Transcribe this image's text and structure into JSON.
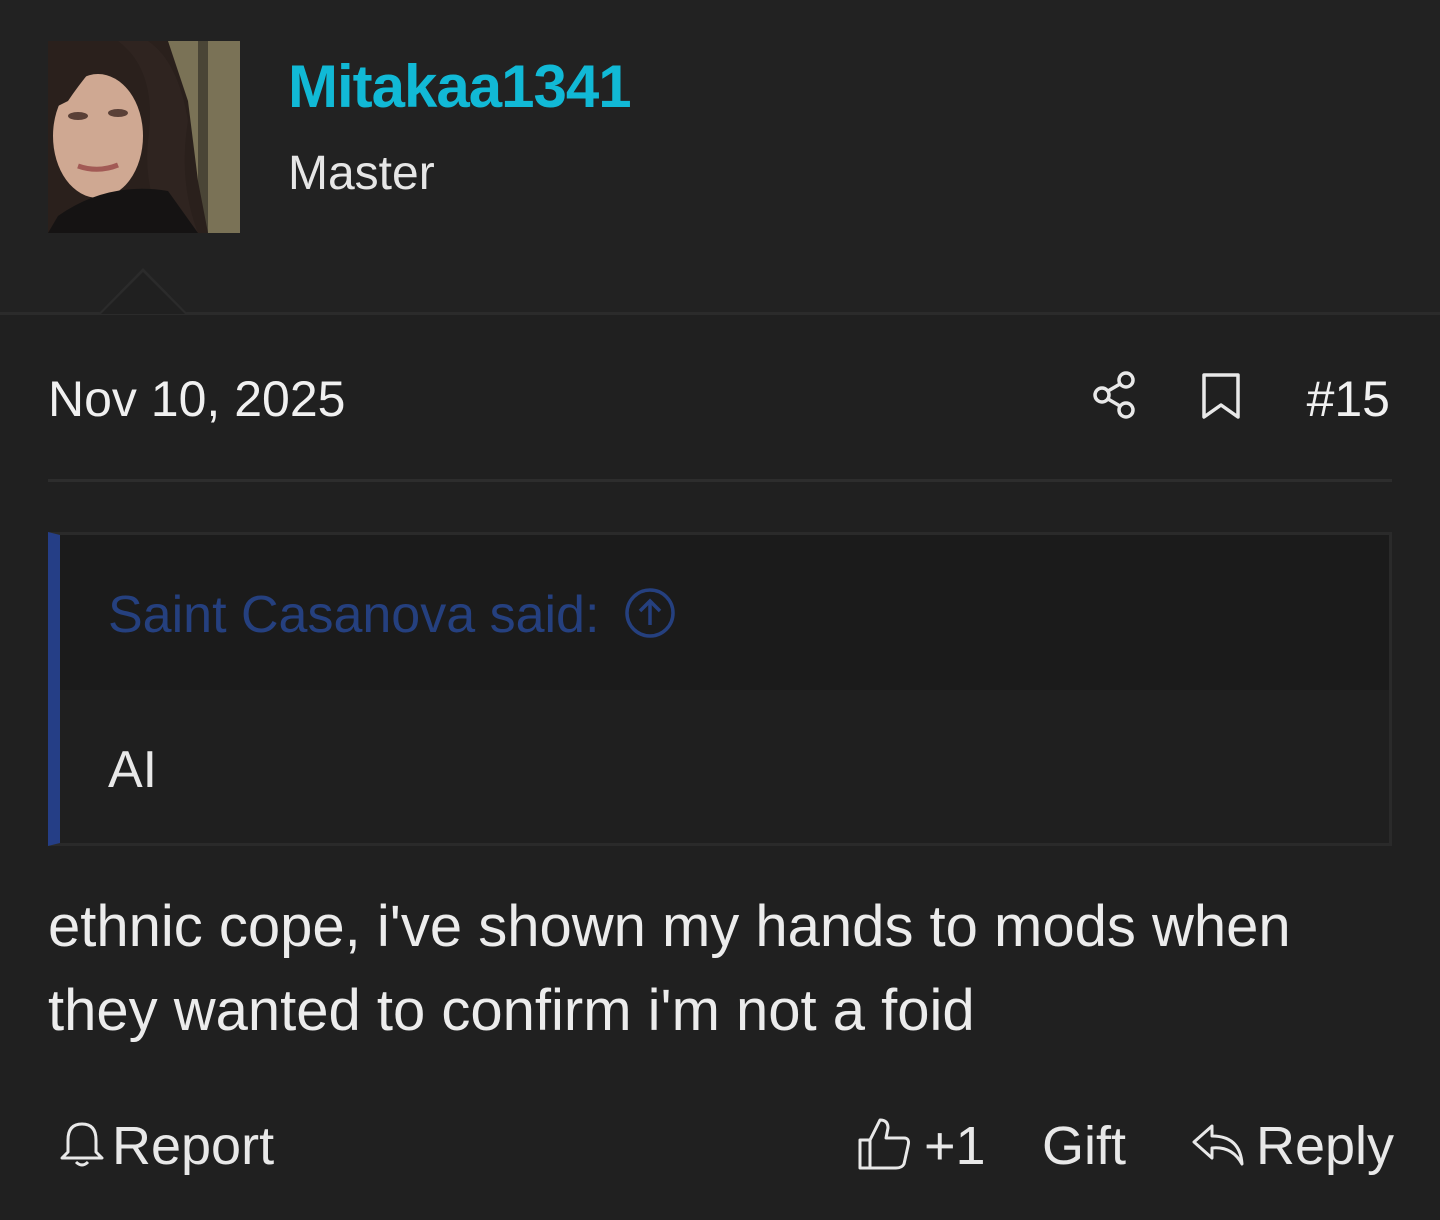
{
  "user": {
    "name": "Mitakaa1341",
    "title": "Master"
  },
  "post": {
    "date": "Nov 10, 2025",
    "number": "#15",
    "quote": {
      "author_line": "Saint Casanova said:",
      "text": "AI"
    },
    "message": "ethnic cope, i've shown my hands to mods when they wanted to confirm i'm not a foid"
  },
  "actions": {
    "report": "Report",
    "reaction_count": "+1",
    "gift": "Gift",
    "reply": "Reply"
  },
  "colors": {
    "username": "#11b9d6",
    "quote_accent": "#253e86",
    "background": "#202020"
  },
  "icons": [
    "share-icon",
    "bookmark-icon",
    "arrow-up-circle-icon",
    "bell-icon",
    "thumbs-up-icon",
    "reply-arrow-icon"
  ]
}
